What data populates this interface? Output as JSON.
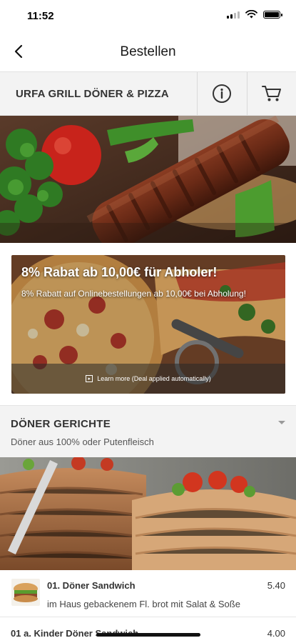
{
  "status_bar": {
    "time": "11:52"
  },
  "nav": {
    "title": "Bestellen",
    "back_icon": "chevron-left-icon"
  },
  "restaurant": {
    "name": "URFA GRILL DÖNER & PIZZA",
    "info_icon": "info-icon",
    "cart_icon": "cart-icon"
  },
  "promo": {
    "title": "8% Rabat ab 10,00€ für Abholer!",
    "description": "8% Rabatt auf Onlinebestellungen ab 10,00€ bei Abholung!",
    "learn_more": "Learn more (Deal applied automatically)"
  },
  "category": {
    "title": "DÖNER GERICHTE",
    "subtitle": "Döner aus 100% oder Putenfleisch"
  },
  "menu_items": [
    {
      "name": "01. Döner Sandwich",
      "description": "im Haus gebackenem Fl. brot mit Salat & Soße",
      "price": "5.40"
    },
    {
      "name": "01 a. Kinder Döner Sandwich",
      "price": "4.00"
    }
  ],
  "colors": {
    "background": "#ffffff",
    "bar": "#f3f3f3",
    "text": "#333333"
  }
}
